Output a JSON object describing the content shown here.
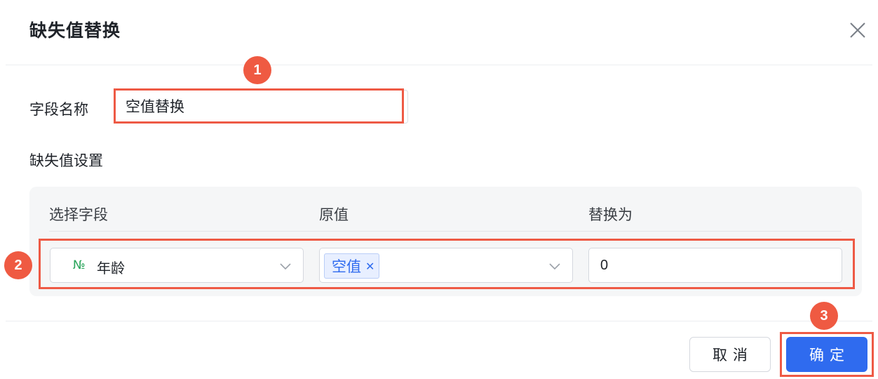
{
  "dialog": {
    "title": "缺失值替换",
    "field_name_label": "字段名称",
    "field_name_value": "空值替换",
    "section_label": "缺失值设置"
  },
  "table": {
    "headers": [
      "选择字段",
      "原值",
      "替换为"
    ],
    "row": {
      "field_icon": "№",
      "field_name": "年龄",
      "original_tag": "空值",
      "replace_value": "0"
    }
  },
  "footer": {
    "cancel_label": "取消",
    "ok_label": "确定"
  },
  "callouts": [
    "1",
    "2",
    "3"
  ],
  "colors": {
    "primary": "#2f6bef",
    "callout": "#ef5a42",
    "highlight_border": "#ee5a45",
    "number_icon": "#2aa55b"
  },
  "icons": {
    "close": "close-icon",
    "field_type": "number-type-icon",
    "dropdown": "chevron-down-icon",
    "tag_remove": "tag-remove-icon"
  }
}
